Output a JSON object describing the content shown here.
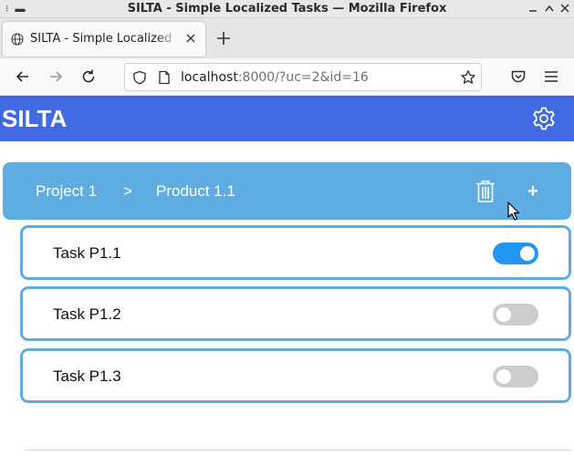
{
  "window": {
    "title": "SILTA - Simple Localized Tasks — Mozilla Firefox",
    "controls": [
      "minimize",
      "maximize",
      "close"
    ]
  },
  "browser": {
    "tab_title": "SILTA - Simple Localized Tasks",
    "url_host": "localhost",
    "url_rest": ":8000/?uc=2&id=16"
  },
  "app": {
    "title": "SILTA",
    "header_color": "#4169e1",
    "accent_color": "#5dade2",
    "toggle_on_color": "#2196f3",
    "breadcrumb": {
      "project": "Project 1",
      "separator": ">",
      "product": "Product 1.1"
    },
    "add_label": "+",
    "tasks": [
      {
        "name": "Task P1.1",
        "done": true
      },
      {
        "name": "Task P1.2",
        "done": false
      },
      {
        "name": "Task P1.3",
        "done": false
      }
    ]
  }
}
